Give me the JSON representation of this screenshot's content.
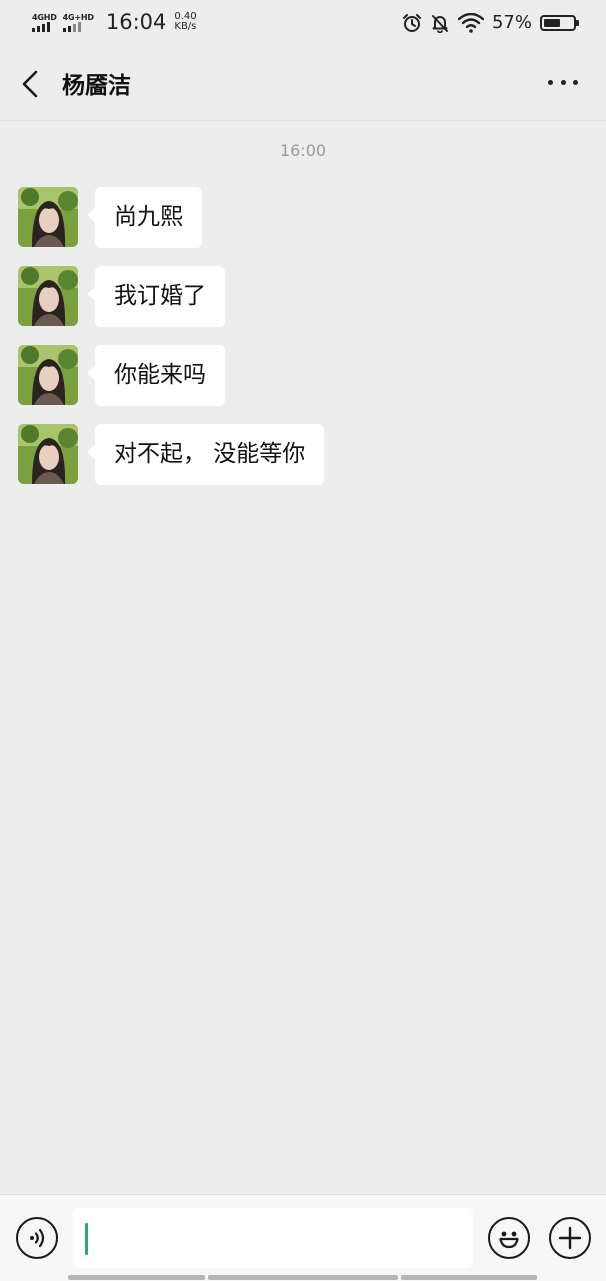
{
  "status_bar": {
    "sim1_label": "4GHD",
    "sim2_label": "4G+HD",
    "time": "16:04",
    "speed_value": "0.40",
    "speed_unit": "KB/s",
    "battery_percent": "57%",
    "battery_level": 0.57,
    "icons": [
      "alarm-icon",
      "bell-off-icon",
      "wifi-icon",
      "battery-icon"
    ]
  },
  "header": {
    "title": "杨靥洁",
    "back_icon": "chevron-left-icon",
    "more_icon": "more-dots-icon"
  },
  "chat": {
    "timestamp": "16:00",
    "messages": [
      {
        "sender": "contact",
        "text": "尚九熙"
      },
      {
        "sender": "contact",
        "text": "我订婚了"
      },
      {
        "sender": "contact",
        "text": "你能来吗"
      },
      {
        "sender": "contact",
        "text": "对不起， 没能等你"
      }
    ]
  },
  "input_bar": {
    "value": "",
    "voice_icon": "voice-input-icon",
    "emoji_icon": "emoji-icon",
    "plus_icon": "plus-icon"
  },
  "colors": {
    "background": "#ededed",
    "bubble": "#ffffff",
    "cursor": "#2aae67"
  }
}
